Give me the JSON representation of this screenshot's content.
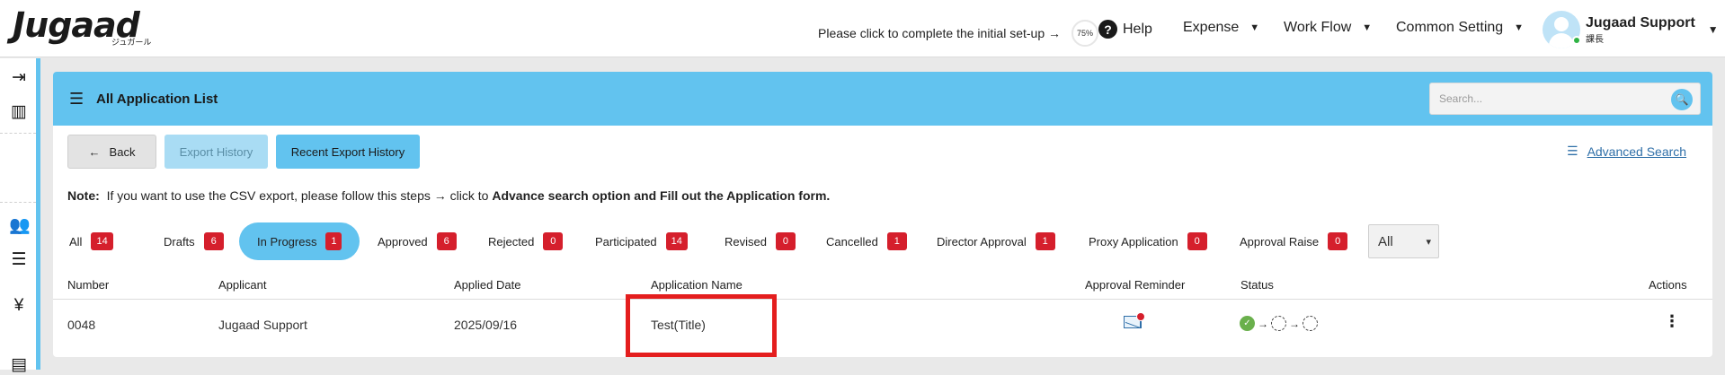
{
  "header": {
    "logo_text": "Jugaad",
    "logo_sub": "ジュガール",
    "setup_text": "Please click to complete the initial set-up →",
    "setup_progress": "75%",
    "help_label": "Help",
    "nav": [
      {
        "label": "Expense"
      },
      {
        "label": "Work Flow"
      },
      {
        "label": "Common Setting"
      }
    ],
    "user": {
      "name": "Jugaad Support",
      "role": "課長"
    }
  },
  "page": {
    "title": "All Application List",
    "search_placeholder": "Search...",
    "buttons": {
      "back": "Back",
      "export_history": "Export History",
      "recent_export_history": "Recent Export History"
    },
    "advanced_search": "Advanced Search",
    "note_label": "Note:",
    "note_text": "If you want to use the CSV export, please follow this steps → click to ",
    "note_bold": "Advance search option and Fill out the Application form.",
    "tabs": [
      {
        "label": "All",
        "count": "14"
      },
      {
        "label": "Drafts",
        "count": "6"
      },
      {
        "label": "In Progress",
        "count": "1"
      },
      {
        "label": "Approved",
        "count": "6"
      },
      {
        "label": "Rejected",
        "count": "0"
      },
      {
        "label": "Participated",
        "count": "14"
      },
      {
        "label": "Revised",
        "count": "0"
      },
      {
        "label": "Cancelled",
        "count": "1"
      },
      {
        "label": "Director Approval",
        "count": "1"
      },
      {
        "label": "Proxy Application",
        "count": "0"
      },
      {
        "label": "Approval Raise",
        "count": "0"
      }
    ],
    "active_tab": "In Progress",
    "filter_select": "All",
    "table": {
      "columns": [
        "Number",
        "Applicant",
        "Applied Date",
        "Application Name",
        "Approval Reminder",
        "Status",
        "Actions"
      ],
      "rows": [
        {
          "number": "0048",
          "applicant": "Jugaad Support",
          "applied_date": "2025/09/16",
          "application_name": "Test(Title)",
          "actions": "⋮"
        }
      ]
    }
  },
  "colors": {
    "accent": "#62c3ef",
    "badge": "#d51f2c",
    "highlight": "#e41e1e",
    "status_done": "#6ab04c"
  },
  "icons": {
    "search": "search-icon",
    "help": "help-icon",
    "back": "arrow-left-icon",
    "advanced_search": "filter-search-icon",
    "list": "list-icon",
    "mail": "mail-reminder-icon"
  }
}
